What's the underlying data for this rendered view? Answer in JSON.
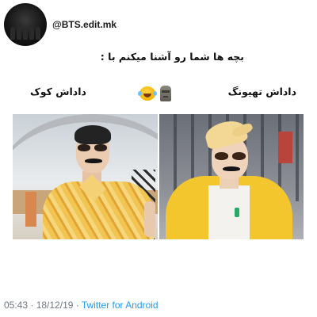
{
  "author": {
    "handle": "@BTS.edit.mk"
  },
  "tweet": {
    "text": "بچه ها شما رو آشنا میکنم با :",
    "label_right": "داداش تهیونگ",
    "label_left": "داداش کوک",
    "emojis": [
      "face-with-tears-of-joy-icon",
      "moai-icon"
    ]
  },
  "footer": {
    "time": "05:43",
    "separator1": " · ",
    "date": "18/12/19",
    "separator2": " · ",
    "app": "Twitter for Android"
  }
}
